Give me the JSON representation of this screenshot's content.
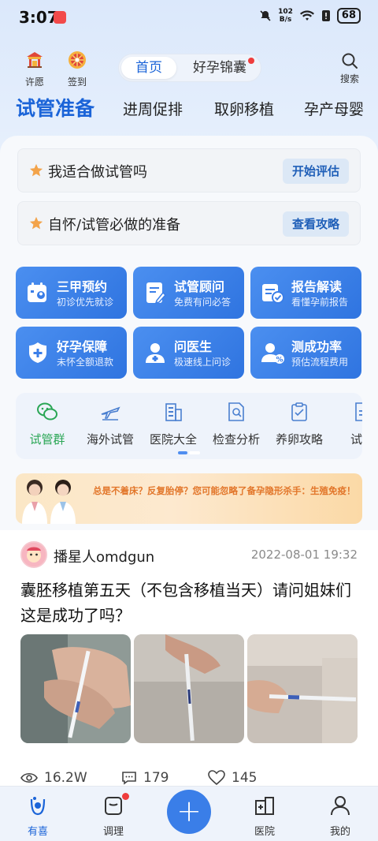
{
  "status_bar": {
    "time": "3:07",
    "net_speed": "102",
    "net_unit": "B/s",
    "battery": "68"
  },
  "top_nav": {
    "wish_label": "许愿",
    "checkin_label": "签到",
    "segments": [
      "首页",
      "好孕锦囊"
    ],
    "search_label": "搜索"
  },
  "tabs": [
    "试管准备",
    "进周促排",
    "取卵移植",
    "孕产母婴"
  ],
  "quick_rows": [
    {
      "text": "我适合做试管吗",
      "button": "开始评估"
    },
    {
      "text": "自怀/试管必做的准备",
      "button": "查看攻略"
    }
  ],
  "services": [
    {
      "title": "三甲预约",
      "subtitle": "初诊优先就诊",
      "icon": "calendar-user-icon"
    },
    {
      "title": "试管顾问",
      "subtitle": "免费有问必答",
      "icon": "document-pen-icon"
    },
    {
      "title": "报告解读",
      "subtitle": "看懂孕前报告",
      "icon": "report-check-icon"
    },
    {
      "title": "好孕保障",
      "subtitle": "未怀全额退款",
      "icon": "shield-plus-icon"
    },
    {
      "title": "问医生",
      "subtitle": "极速线上问诊",
      "icon": "doctor-icon"
    },
    {
      "title": "测成功率",
      "subtitle": "预估流程费用",
      "icon": "user-percent-icon"
    }
  ],
  "shortcuts": [
    {
      "label": "试管群",
      "icon": "wechat-icon"
    },
    {
      "label": "海外试管",
      "icon": "plane-icon"
    },
    {
      "label": "医院大全",
      "icon": "hospital-building-icon"
    },
    {
      "label": "检查分析",
      "icon": "search-doc-icon"
    },
    {
      "label": "养卵攻略",
      "icon": "clipboard-icon"
    },
    {
      "label": "试管",
      "icon": "document-icon"
    }
  ],
  "banner": {
    "text": "总是不着床？反复胎停？您可能忽略了备孕隐形杀手：生殖免疫！"
  },
  "post": {
    "username": "播星人omdgun",
    "time": "2022-08-01 19:32",
    "title": "囊胚移植第五天（不包含移植当天）请问姐妹们这是成功了吗？",
    "views": "16.2W",
    "comments": "179",
    "likes": "145"
  },
  "bottom_nav": {
    "items": [
      "有喜",
      "调理",
      "医院",
      "我的"
    ],
    "fab": "+"
  },
  "colors": {
    "accent": "#1b64d8",
    "service_blue": "#3a7ee8",
    "green_active": "#2aa655",
    "badge_red": "#ef3d3d"
  }
}
